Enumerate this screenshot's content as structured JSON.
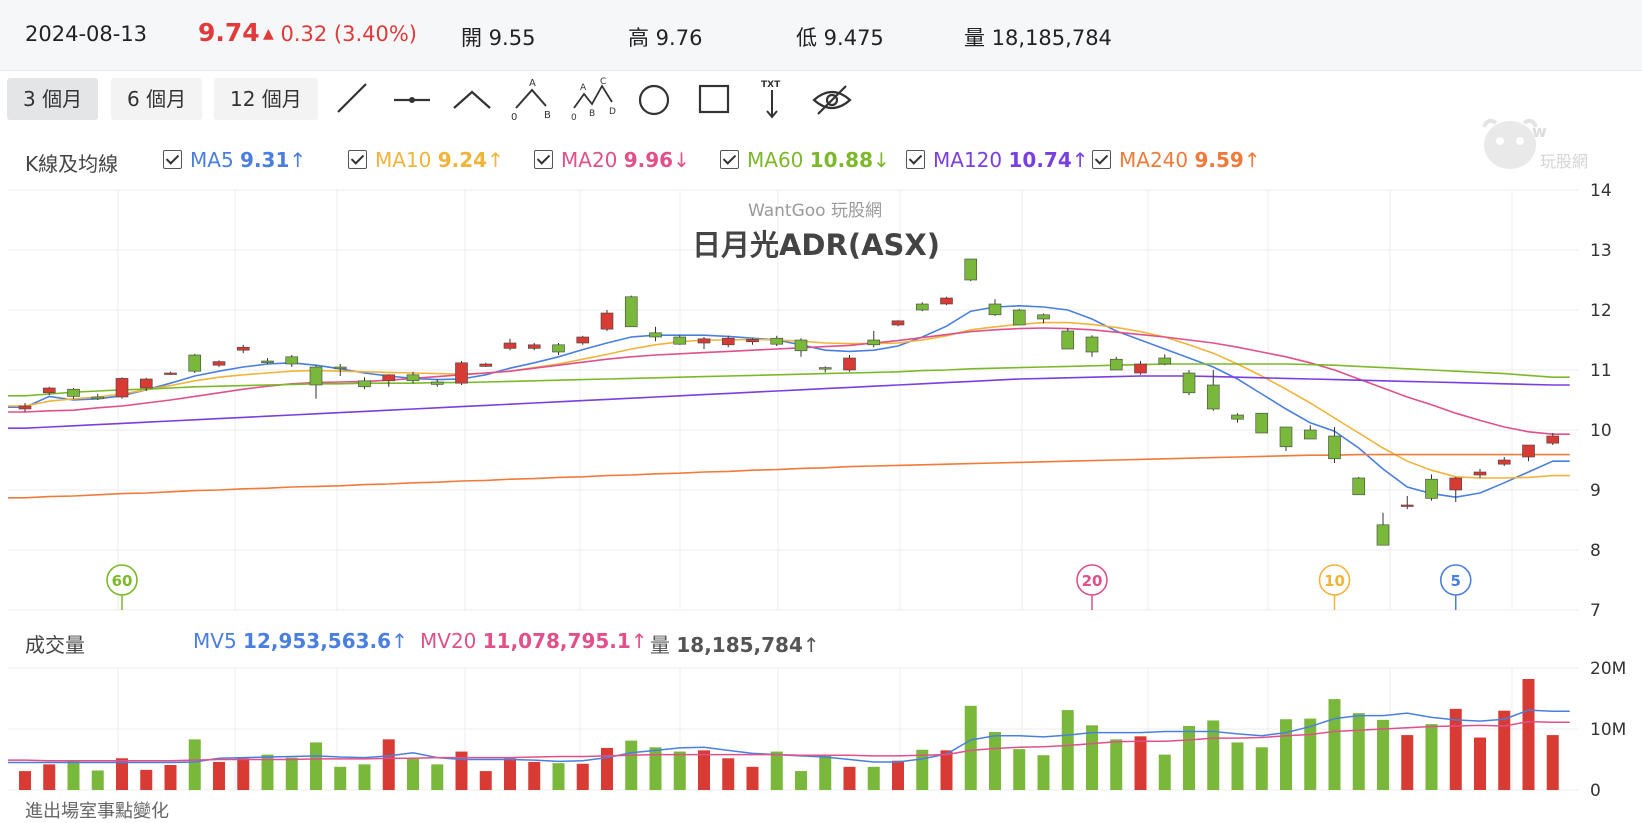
{
  "quote": {
    "date": "2024-08-13",
    "price": "9.74",
    "change": "0.32 (3.40%)",
    "open": "開 9.55",
    "high": "高 9.76",
    "low": "低 9.475",
    "volume": "量 18,185,784"
  },
  "ranges": [
    "3 個月",
    "6 個月",
    "12 個月"
  ],
  "active_range": "3 個月",
  "tools": [
    "line-tool-icon",
    "horizontal-line-tool-icon",
    "angle-tool-icon",
    "abc-pattern-tool-icon",
    "abcd-pattern-tool-icon",
    "circle-tool-icon",
    "rectangle-tool-icon",
    "text-arrow-tool-icon",
    "hide-drawings-icon"
  ],
  "ma_legend": {
    "title": "K線及均線",
    "items": [
      {
        "name": "MA5",
        "value": "9.31",
        "trend": "↑",
        "color": "#4a7fe0"
      },
      {
        "name": "MA10",
        "value": "9.24",
        "trend": "↑",
        "color": "#f0b43a"
      },
      {
        "name": "MA20",
        "value": "9.96",
        "trend": "↓",
        "color": "#e0508a"
      },
      {
        "name": "MA60",
        "value": "10.88",
        "trend": "↓",
        "color": "#7cb92a"
      },
      {
        "name": "MA120",
        "value": "10.74",
        "trend": "↑",
        "color": "#7a3fe0"
      },
      {
        "name": "MA240",
        "value": "9.59",
        "trend": "↑",
        "color": "#f07a3a"
      }
    ]
  },
  "watermark": "WantGoo 玩股網",
  "logo_text": "玩股網",
  "vol_legend": {
    "title": "成交量",
    "items": [
      {
        "name": "MV5",
        "value": "12,953,563.6",
        "trend": "↑",
        "color": "#4a7fe0"
      },
      {
        "name": "MV20",
        "value": "11,078,795.1",
        "trend": "↑",
        "color": "#e0508a"
      },
      {
        "name": "量",
        "value": "18,185,784",
        "trend": "↑",
        "color": "#555555"
      }
    ]
  },
  "footer_text": "進出場室事點變化",
  "colors": {
    "up": "#d83a34",
    "down": "#79b83a",
    "grid": "#ececec"
  },
  "chart_data": {
    "type": "candlestick",
    "title": "日月光ADR(ASX)",
    "price_axis": {
      "ylim": [
        7,
        14
      ],
      "ticks": [
        14,
        13,
        12,
        11,
        10,
        9,
        8,
        7
      ]
    },
    "volume_axis": {
      "ylim": [
        0,
        20
      ],
      "ticks": [
        "20M",
        "10M",
        "0"
      ]
    },
    "markers": [
      {
        "label": "60",
        "index": 4,
        "color": "#7cb92a"
      },
      {
        "label": "20",
        "index": 44,
        "color": "#e0508a"
      },
      {
        "label": "10",
        "index": 54,
        "color": "#f0b43a"
      },
      {
        "label": "5",
        "index": 59,
        "color": "#4a7fe0"
      }
    ],
    "candles": [
      [
        10.35,
        10.45,
        10.3,
        10.4
      ],
      [
        10.62,
        10.72,
        10.58,
        10.7
      ],
      [
        10.68,
        10.7,
        10.52,
        10.56
      ],
      [
        10.55,
        10.6,
        10.5,
        10.52
      ],
      [
        10.55,
        10.88,
        10.52,
        10.86
      ],
      [
        10.7,
        10.87,
        10.65,
        10.85
      ],
      [
        10.95,
        10.97,
        10.92,
        10.95
      ],
      [
        11.25,
        11.27,
        10.95,
        10.98
      ],
      [
        11.08,
        11.16,
        11.05,
        11.14
      ],
      [
        11.33,
        11.42,
        11.28,
        11.38
      ],
      [
        11.15,
        11.2,
        11.1,
        11.12
      ],
      [
        11.22,
        11.25,
        11.05,
        11.1
      ],
      [
        11.05,
        11.08,
        10.52,
        10.75
      ],
      [
        11.05,
        11.1,
        10.9,
        11.02
      ],
      [
        10.82,
        10.88,
        10.68,
        10.72
      ],
      [
        10.82,
        10.93,
        10.72,
        10.92
      ],
      [
        10.92,
        10.97,
        10.78,
        10.82
      ],
      [
        10.8,
        10.85,
        10.72,
        10.76
      ],
      [
        10.78,
        11.15,
        10.75,
        11.12
      ],
      [
        11.06,
        11.12,
        11.05,
        11.1
      ],
      [
        11.36,
        11.52,
        11.33,
        11.45
      ],
      [
        11.36,
        11.45,
        11.33,
        11.42
      ],
      [
        11.42,
        11.45,
        11.25,
        11.3
      ],
      [
        11.45,
        11.57,
        11.42,
        11.55
      ],
      [
        11.68,
        12.0,
        11.65,
        11.95
      ],
      [
        12.22,
        12.24,
        11.72,
        11.72
      ],
      [
        11.62,
        11.72,
        11.48,
        11.55
      ],
      [
        11.55,
        11.58,
        11.42,
        11.43
      ],
      [
        11.45,
        11.55,
        11.35,
        11.52
      ],
      [
        11.42,
        11.57,
        11.38,
        11.53
      ],
      [
        11.47,
        11.53,
        11.42,
        11.51
      ],
      [
        11.53,
        11.57,
        11.4,
        11.43
      ],
      [
        11.5,
        11.53,
        11.22,
        11.32
      ],
      [
        11.04,
        11.06,
        10.96,
        11.02
      ],
      [
        11.0,
        11.25,
        10.97,
        11.2
      ],
      [
        11.5,
        11.65,
        11.38,
        11.42
      ],
      [
        11.75,
        11.83,
        11.73,
        11.82
      ],
      [
        12.1,
        12.13,
        11.98,
        12.0
      ],
      [
        12.1,
        12.22,
        12.08,
        12.2
      ],
      [
        12.85,
        12.85,
        12.48,
        12.5
      ],
      [
        12.1,
        12.18,
        11.9,
        11.92
      ],
      [
        12.0,
        12.02,
        11.75,
        11.75
      ],
      [
        11.92,
        11.94,
        11.78,
        11.85
      ],
      [
        11.65,
        11.7,
        11.35,
        11.35
      ],
      [
        11.55,
        11.58,
        11.22,
        11.3
      ],
      [
        11.18,
        11.22,
        11.0,
        11.0
      ],
      [
        10.95,
        11.15,
        10.92,
        11.1
      ],
      [
        11.2,
        11.26,
        11.08,
        11.1
      ],
      [
        10.95,
        11.0,
        10.58,
        10.62
      ],
      [
        10.75,
        11.0,
        10.32,
        10.35
      ],
      [
        10.25,
        10.28,
        10.12,
        10.18
      ],
      [
        10.28,
        10.28,
        9.95,
        9.95
      ],
      [
        10.05,
        10.05,
        9.65,
        9.72
      ],
      [
        10.0,
        10.08,
        9.85,
        9.85
      ],
      [
        9.9,
        10.05,
        9.45,
        9.52
      ],
      [
        9.2,
        9.22,
        8.92,
        8.92
      ],
      [
        8.42,
        8.62,
        8.08,
        8.08
      ],
      [
        8.75,
        8.9,
        8.68,
        8.75
      ],
      [
        9.18,
        9.26,
        8.82,
        8.86
      ],
      [
        9.0,
        9.22,
        8.8,
        9.2
      ],
      [
        9.25,
        9.35,
        9.2,
        9.3
      ],
      [
        9.43,
        9.55,
        9.4,
        9.5
      ],
      [
        9.55,
        9.75,
        9.48,
        9.75
      ],
      [
        9.78,
        9.95,
        9.75,
        9.9
      ]
    ],
    "volumes_m": [
      3.1,
      4.2,
      4.8,
      3.2,
      5.2,
      3.3,
      4.1,
      8.3,
      4.6,
      5.2,
      5.8,
      5.3,
      7.8,
      3.8,
      4.2,
      8.3,
      5.1,
      4.2,
      6.3,
      3.1,
      5.2,
      4.6,
      4.4,
      4.3,
      6.9,
      8.1,
      7.0,
      6.3,
      6.5,
      5.2,
      3.8,
      6.3,
      3.1,
      5.7,
      3.8,
      3.8,
      4.8,
      6.6,
      6.5,
      13.8,
      9.5,
      6.7,
      5.7,
      13.1,
      10.6,
      8.3,
      8.8,
      5.8,
      10.5,
      11.4,
      7.8,
      7.0,
      11.6,
      11.7,
      14.9,
      12.6,
      11.5,
      9.0,
      10.8,
      13.3,
      8.6,
      13.0,
      18.2,
      9.0
    ],
    "ma_lines": {
      "MA5": [
        10.38,
        10.56,
        10.5,
        10.52,
        10.57,
        10.67,
        10.78,
        10.9,
        10.98,
        11.05,
        11.1,
        11.12,
        11.08,
        11.02,
        10.95,
        10.9,
        10.86,
        10.84,
        10.85,
        10.92,
        11.03,
        11.12,
        11.22,
        11.34,
        11.45,
        11.55,
        11.58,
        11.58,
        11.58,
        11.56,
        11.53,
        11.5,
        11.42,
        11.33,
        11.31,
        11.33,
        11.4,
        11.55,
        11.73,
        11.98,
        12.05,
        12.07,
        12.05,
        12.0,
        11.85,
        11.65,
        11.5,
        11.35,
        11.2,
        11.05,
        10.85,
        10.6,
        10.35,
        10.12,
        9.98,
        9.7,
        9.35,
        9.05,
        8.94,
        8.88,
        8.95,
        9.12,
        9.3,
        9.48
      ],
      "MA10": [
        10.4,
        10.48,
        10.52,
        10.55,
        10.6,
        10.67,
        10.74,
        10.82,
        10.88,
        10.92,
        10.95,
        10.98,
        10.99,
        10.98,
        10.97,
        10.96,
        10.95,
        10.94,
        10.93,
        10.95,
        10.98,
        11.04,
        11.1,
        11.18,
        11.26,
        11.35,
        11.42,
        11.47,
        11.5,
        11.5,
        11.51,
        11.5,
        11.48,
        11.45,
        11.44,
        11.44,
        11.45,
        11.5,
        11.57,
        11.67,
        11.72,
        11.76,
        11.79,
        11.79,
        11.76,
        11.71,
        11.64,
        11.55,
        11.42,
        11.28,
        11.1,
        10.9,
        10.68,
        10.45,
        10.2,
        9.95,
        9.7,
        9.48,
        9.33,
        9.22,
        9.2,
        9.2,
        9.21,
        9.24
      ],
      "MA20": [
        10.3,
        10.32,
        10.33,
        10.37,
        10.4,
        10.45,
        10.5,
        10.56,
        10.62,
        10.68,
        10.73,
        10.77,
        10.79,
        10.8,
        10.81,
        10.83,
        10.86,
        10.89,
        10.92,
        10.95,
        10.98,
        11.03,
        11.08,
        11.13,
        11.18,
        11.22,
        11.25,
        11.27,
        11.29,
        11.31,
        11.33,
        11.35,
        11.37,
        11.39,
        11.41,
        11.45,
        11.49,
        11.54,
        11.59,
        11.64,
        11.67,
        11.69,
        11.7,
        11.69,
        11.67,
        11.63,
        11.59,
        11.55,
        11.5,
        11.45,
        11.38,
        11.3,
        11.22,
        11.12,
        11.0,
        10.85,
        10.7,
        10.55,
        10.42,
        10.28,
        10.16,
        10.05,
        9.97,
        9.93
      ],
      "MA60": [
        10.57,
        10.6,
        10.63,
        10.65,
        10.67,
        10.68,
        10.7,
        10.72,
        10.73,
        10.74,
        10.75,
        10.76,
        10.77,
        10.77,
        10.78,
        10.78,
        10.78,
        10.79,
        10.79,
        10.8,
        10.81,
        10.82,
        10.83,
        10.84,
        10.85,
        10.86,
        10.87,
        10.88,
        10.89,
        10.9,
        10.91,
        10.92,
        10.93,
        10.94,
        10.95,
        10.96,
        10.97,
        10.99,
        11.0,
        11.02,
        11.03,
        11.04,
        11.05,
        11.06,
        11.07,
        11.08,
        11.09,
        11.1,
        11.1,
        11.1,
        11.1,
        11.1,
        11.1,
        11.09,
        11.08,
        11.06,
        11.04,
        11.02,
        11.0,
        10.98,
        10.96,
        10.94,
        10.91,
        10.88
      ],
      "MA120": [
        10.03,
        10.05,
        10.07,
        10.09,
        10.11,
        10.13,
        10.15,
        10.17,
        10.19,
        10.21,
        10.23,
        10.25,
        10.27,
        10.29,
        10.31,
        10.33,
        10.35,
        10.37,
        10.39,
        10.41,
        10.43,
        10.45,
        10.47,
        10.49,
        10.51,
        10.53,
        10.55,
        10.57,
        10.59,
        10.61,
        10.63,
        10.65,
        10.67,
        10.69,
        10.71,
        10.73,
        10.75,
        10.77,
        10.79,
        10.81,
        10.83,
        10.85,
        10.86,
        10.87,
        10.88,
        10.89,
        10.9,
        10.9,
        10.9,
        10.89,
        10.88,
        10.87,
        10.86,
        10.85,
        10.84,
        10.83,
        10.82,
        10.81,
        10.8,
        10.79,
        10.78,
        10.77,
        10.76,
        10.75
      ],
      "MA240": [
        8.87,
        8.89,
        8.9,
        8.92,
        8.94,
        8.95,
        8.97,
        8.99,
        9.0,
        9.02,
        9.03,
        9.05,
        9.06,
        9.07,
        9.09,
        9.1,
        9.12,
        9.13,
        9.15,
        9.16,
        9.18,
        9.19,
        9.21,
        9.22,
        9.24,
        9.25,
        9.27,
        9.28,
        9.3,
        9.31,
        9.33,
        9.34,
        9.36,
        9.37,
        9.39,
        9.4,
        9.41,
        9.42,
        9.43,
        9.44,
        9.45,
        9.46,
        9.47,
        9.48,
        9.49,
        9.5,
        9.51,
        9.52,
        9.53,
        9.54,
        9.55,
        9.56,
        9.57,
        9.58,
        9.58,
        9.59,
        9.59,
        9.59,
        9.59,
        9.59,
        9.59,
        9.59,
        9.59,
        9.59
      ]
    },
    "mv_lines": {
      "MV5": [
        4.5,
        4.5,
        4.5,
        4.5,
        4.5,
        4.5,
        4.5,
        4.6,
        5.2,
        5.3,
        5.4,
        5.5,
        5.6,
        5.4,
        5.3,
        5.6,
        6.1,
        5.3,
        5.0,
        5.0,
        5.0,
        4.9,
        4.7,
        4.8,
        5.3,
        6.1,
        6.5,
        6.9,
        7.0,
        6.5,
        6.0,
        5.8,
        5.6,
        5.4,
        5.0,
        4.6,
        4.6,
        5.1,
        5.9,
        8.2,
        8.9,
        8.9,
        8.7,
        9.0,
        9.4,
        9.4,
        9.4,
        9.6,
        9.6,
        9.6,
        9.2,
        8.9,
        9.4,
        10.4,
        11.7,
        12.2,
        12.2,
        12.6,
        11.9,
        11.5,
        11.3,
        11.6,
        13.1,
        12.9
      ],
      "MV20": [
        4.9,
        4.8,
        4.8,
        4.8,
        4.8,
        4.8,
        4.8,
        4.9,
        5.0,
        5.0,
        5.0,
        5.0,
        5.1,
        5.1,
        5.1,
        5.2,
        5.2,
        5.3,
        5.3,
        5.3,
        5.3,
        5.4,
        5.5,
        5.5,
        5.6,
        5.7,
        5.8,
        5.8,
        5.8,
        5.8,
        5.8,
        5.8,
        5.7,
        5.7,
        5.7,
        5.6,
        5.6,
        5.7,
        5.8,
        6.5,
        6.8,
        7.0,
        7.1,
        7.3,
        7.6,
        7.9,
        8.0,
        8.0,
        8.2,
        8.5,
        8.5,
        8.6,
        8.9,
        9.1,
        9.6,
        9.8,
        10.0,
        10.2,
        10.4,
        10.5,
        10.6,
        10.5,
        11.2,
        11.1
      ]
    }
  }
}
